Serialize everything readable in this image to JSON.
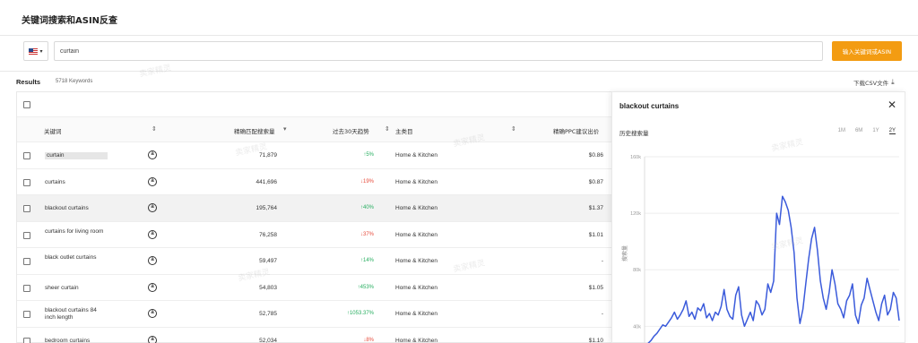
{
  "header": {
    "title": "关键词搜索和ASIN反查"
  },
  "search": {
    "country_flag": "us-flag-icon",
    "value": "curtain",
    "button_label": "输入关键词或ASIN"
  },
  "results": {
    "label": "Results",
    "count": "5718 Keywords",
    "csv_label": "下载CSV文件"
  },
  "table": {
    "columns": [
      "关键词",
      "精确匹配搜索量",
      "过去30天趋势",
      "主类目",
      "精确PPC建议出价"
    ],
    "rows": [
      {
        "keyword": "curtain",
        "volume": "71,879",
        "trend": "5%",
        "dir": "up",
        "category": "Home & Kitchen",
        "ppc": "$0.86",
        "tag": true
      },
      {
        "keyword": "curtains",
        "volume": "441,696",
        "trend": "19%",
        "dir": "down",
        "category": "Home & Kitchen",
        "ppc": "$0.87"
      },
      {
        "keyword": "blackout curtains",
        "volume": "195,764",
        "trend": "40%",
        "dir": "up",
        "category": "Home & Kitchen",
        "ppc": "$1.37",
        "highlight": true
      },
      {
        "keyword": "curtains for living room",
        "volume": "76,258",
        "trend": "37%",
        "dir": "down",
        "category": "Home & Kitchen",
        "ppc": "$1.01"
      },
      {
        "keyword": "black outlet curtains",
        "volume": "59,497",
        "trend": "14%",
        "dir": "up",
        "category": "Home & Kitchen",
        "ppc": "-"
      },
      {
        "keyword": "sheer curtain",
        "volume": "54,803",
        "trend": "453%",
        "dir": "up",
        "category": "Home & Kitchen",
        "ppc": "$1.05"
      },
      {
        "keyword": "blackout curtains 84 inch length",
        "volume": "52,785",
        "trend": "1053.37%",
        "dir": "up",
        "category": "Home & Kitchen",
        "ppc": "-"
      },
      {
        "keyword": "bedroom curtains",
        "volume": "52,034",
        "trend": "8%",
        "dir": "down",
        "category": "Home & Kitchen",
        "ppc": "$1.10"
      }
    ]
  },
  "panel": {
    "title": "blackout curtains",
    "history_label": "历史搜索量",
    "ranges": [
      "1M",
      "6M",
      "1Y",
      "2Y"
    ],
    "active_range": "2Y",
    "ylabel": "搜索量"
  },
  "chart_data": {
    "type": "line",
    "ylabel": "搜索量",
    "yticks": [
      "160k",
      "120k",
      "80k",
      "40k"
    ],
    "ylim": [
      25000,
      160000
    ],
    "series": [
      {
        "values": [
          28000,
          30000,
          33000,
          35000,
          38000,
          41000,
          40000,
          43000,
          46000,
          50000,
          45000,
          48000,
          52000,
          58000,
          47000,
          50000,
          45000,
          53000,
          51000,
          56000,
          46000,
          49000,
          44000,
          50000,
          48000,
          54000,
          66000,
          52000,
          47000,
          45000,
          62000,
          68000,
          48000,
          40000,
          45000,
          50000,
          44000,
          58000,
          55000,
          48000,
          52000,
          70000,
          64000,
          72000,
          120000,
          112000,
          132000,
          128000,
          122000,
          110000,
          92000,
          60000,
          42000,
          52000,
          70000,
          88000,
          102000,
          110000,
          94000,
          72000,
          60000,
          52000,
          64000,
          80000,
          70000,
          56000,
          52000,
          46000,
          58000,
          62000,
          70000,
          48000,
          42000,
          55000,
          60000,
          74000,
          66000,
          58000,
          50000,
          44000,
          56000,
          62000,
          48000,
          52000,
          64000,
          60000,
          44000
        ]
      }
    ]
  }
}
